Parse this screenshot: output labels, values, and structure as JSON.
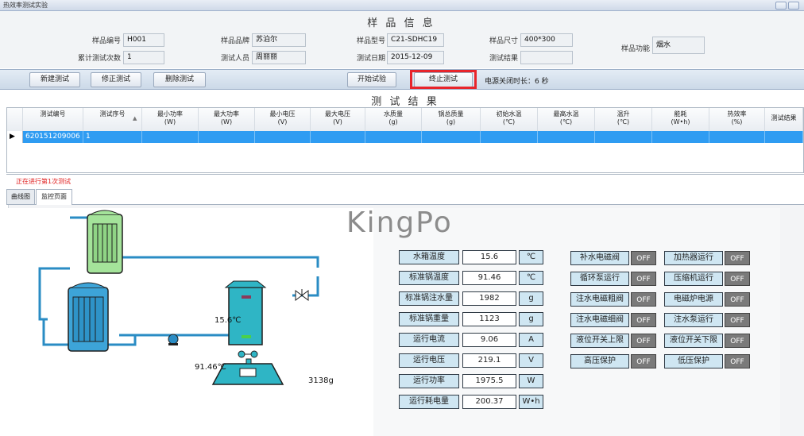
{
  "window": {
    "title": "热效率测试实验"
  },
  "sample_info": {
    "heading": "样 品 信 息",
    "fields": [
      {
        "label": "样品编号",
        "value": "H001"
      },
      {
        "label": "累计测试次数",
        "value": "1"
      },
      {
        "label": "样品品牌",
        "value": "苏泊尔"
      },
      {
        "label": "测试人员",
        "value": "周丽丽"
      },
      {
        "label": "样品型号",
        "value": "C21-SDHC19"
      },
      {
        "label": "测试日期",
        "value": "2015-12-09"
      },
      {
        "label": "样品尺寸",
        "value": "400*300"
      },
      {
        "label": "测试结果",
        "value": ""
      },
      {
        "label": "样品功能",
        "value": "烟水"
      }
    ]
  },
  "toolbar": {
    "new_test": "新建测试",
    "modify_test": "修正测试",
    "delete_test": "删除测试",
    "start_test": "开始试验",
    "stop_test": "终止测试",
    "power_off_label": "电源关闭时长：6 秒"
  },
  "results": {
    "heading": "测 试 结 果",
    "columns": [
      {
        "name": "测试编号",
        "unit": ""
      },
      {
        "name": "测试序号",
        "unit": ""
      },
      {
        "name": "最小功率",
        "unit": "(W)"
      },
      {
        "name": "最大功率",
        "unit": "(W)"
      },
      {
        "name": "最小电压",
        "unit": "(V)"
      },
      {
        "name": "最大电压",
        "unit": "(V)"
      },
      {
        "name": "水质量",
        "unit": "(g)"
      },
      {
        "name": "锅总质量",
        "unit": "(g)"
      },
      {
        "name": "初始水温",
        "unit": "(℃)"
      },
      {
        "name": "最高水温",
        "unit": "(℃)"
      },
      {
        "name": "温升",
        "unit": "(℃)"
      },
      {
        "name": "能耗",
        "unit": "(W•h)"
      },
      {
        "name": "热效率",
        "unit": "(%)"
      },
      {
        "name": "测试结果",
        "unit": ""
      }
    ],
    "rows": [
      [
        "620151209006",
        "1",
        "",
        "",
        "",
        "",
        "",
        "",
        "",
        "",
        "",
        "",
        "",
        ""
      ]
    ]
  },
  "status": {
    "text": "正在进行第1次测试"
  },
  "tabs": {
    "curve": "曲线图",
    "monitor": "监控页面"
  },
  "monitor": {
    "brand": "KingPo",
    "pot_temp": "91.46℃",
    "water_tank_temp": "15.6℃",
    "scale_weight": "3138g",
    "readings": [
      {
        "label": "水箱温度",
        "value": "15.6",
        "unit": "℃"
      },
      {
        "label": "标准锅温度",
        "value": "91.46",
        "unit": "℃"
      },
      {
        "label": "标准锅注水量",
        "value": "1982",
        "unit": "g"
      },
      {
        "label": "标准锅重量",
        "value": "1123",
        "unit": "g"
      },
      {
        "label": "运行电流",
        "value": "9.06",
        "unit": "A"
      },
      {
        "label": "运行电压",
        "value": "219.1",
        "unit": "V"
      },
      {
        "label": "运行功率",
        "value": "1975.5",
        "unit": "W"
      },
      {
        "label": "运行耗电量",
        "value": "200.37",
        "unit": "W•h"
      }
    ],
    "switches": [
      [
        {
          "label": "补水电磁阀",
          "state": "OFF"
        },
        {
          "label": "加热器运行",
          "state": "OFF"
        }
      ],
      [
        {
          "label": "循环泵运行",
          "state": "OFF"
        },
        {
          "label": "压缩机运行",
          "state": "OFF"
        }
      ],
      [
        {
          "label": "注水电磁粗阀",
          "state": "OFF"
        },
        {
          "label": "电磁炉电源",
          "state": "OFF"
        }
      ],
      [
        {
          "label": "注水电磁细阀",
          "state": "OFF"
        },
        {
          "label": "注水泵运行",
          "state": "OFF"
        }
      ],
      [
        {
          "label": "液位开关上限",
          "state": "OFF"
        },
        {
          "label": "液位开关下限",
          "state": "OFF"
        }
      ],
      [
        {
          "label": "高压保护",
          "state": "OFF"
        },
        {
          "label": "低压保护",
          "state": "OFF"
        }
      ]
    ]
  }
}
